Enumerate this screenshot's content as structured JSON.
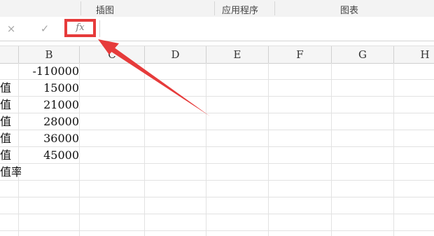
{
  "ribbon": {
    "groups": [
      "插图",
      "应用程序",
      "图表"
    ]
  },
  "formula_bar": {
    "cancel_icon": "×",
    "enter_icon": "✓",
    "fx_label": "fx"
  },
  "columns": [
    "B",
    "C",
    "D",
    "E",
    "F",
    "G",
    "H"
  ],
  "rows": [
    {
      "a": "",
      "b": "-110000"
    },
    {
      "a": "值",
      "b": "15000"
    },
    {
      "a": "值",
      "b": "21000"
    },
    {
      "a": "值",
      "b": "28000"
    },
    {
      "a": "值",
      "b": "36000"
    },
    {
      "a": "值",
      "b": "45000"
    },
    {
      "a": "值率",
      "b": ""
    }
  ],
  "colors": {
    "highlight": "#e63b3b"
  },
  "icons": {
    "cancel": "close-icon",
    "enter": "check-icon",
    "insert_function": "fx-icon"
  }
}
